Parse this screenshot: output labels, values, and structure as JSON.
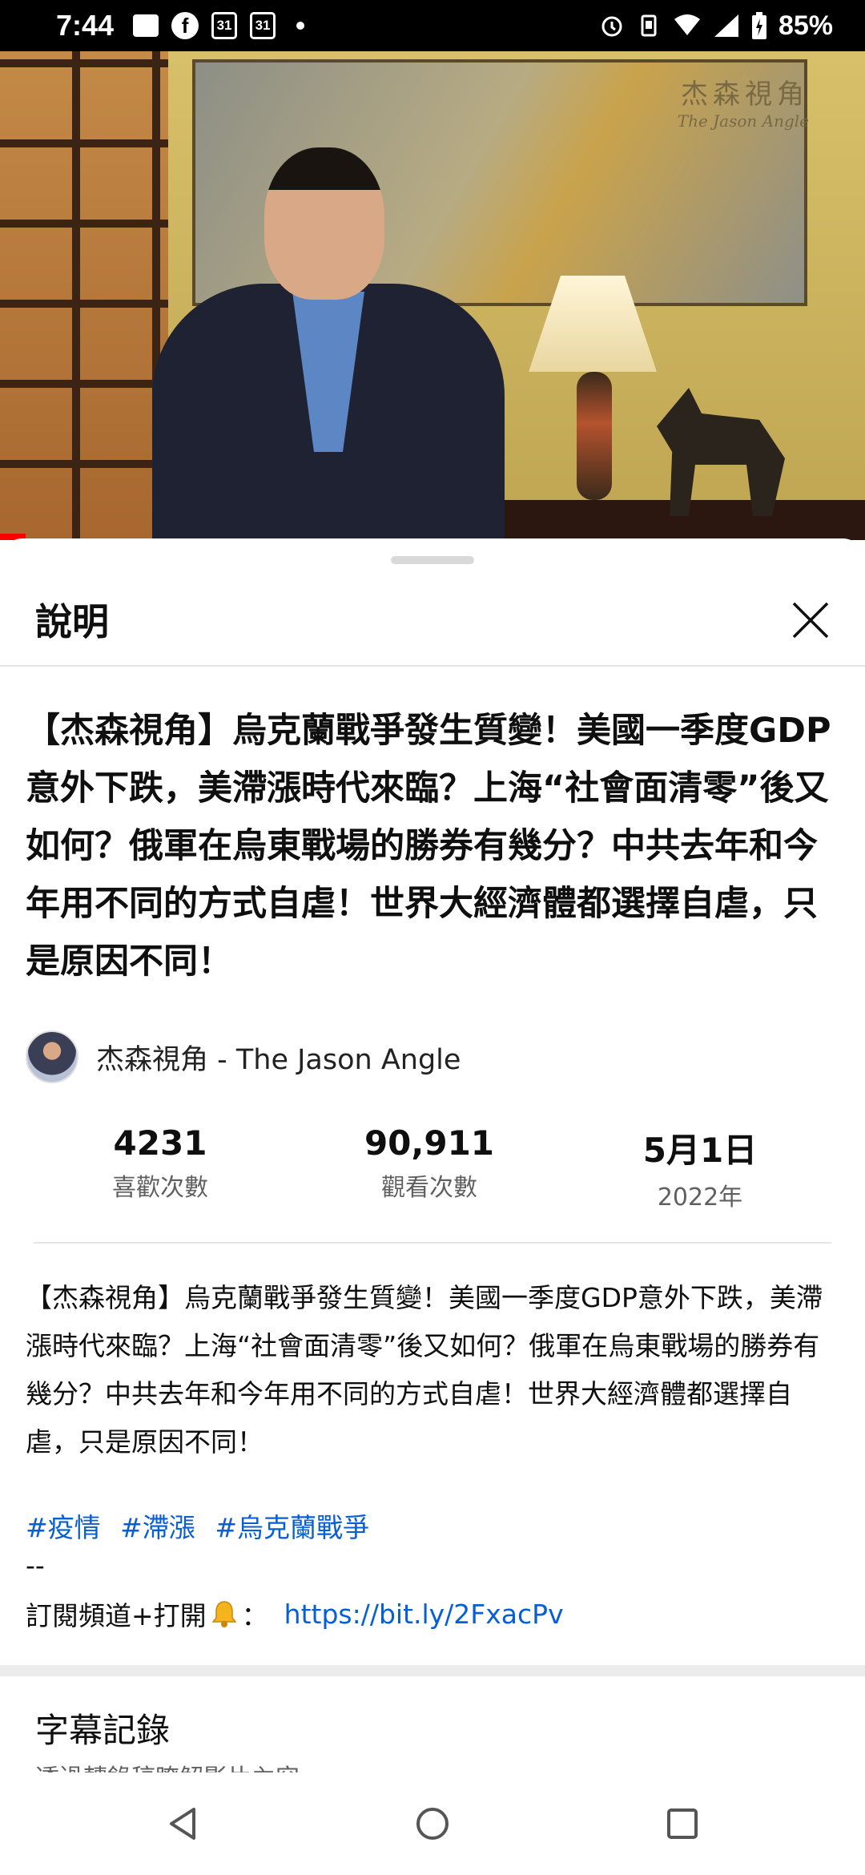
{
  "status_bar": {
    "time": "7:44",
    "calendar_day_1": "31",
    "calendar_day_2": "31",
    "battery": "85%"
  },
  "video": {
    "watermark_cn": "杰森視角",
    "watermark_en": "The Jason Angle",
    "progress_fraction": 0.03
  },
  "sheet": {
    "title": "說明",
    "video_title": "【杰森視角】烏克蘭戰爭發生質變！美國一季度GDP意外下跌，美滯漲時代來臨？上海“社會面清零”後又如何？俄軍在烏東戰場的勝券有幾分？中共去年和今年用不同的方式自虐！世界大經濟體都選擇自虐，只是原因不同！",
    "channel_name": "杰森視角 - The Jason Angle",
    "stats": {
      "likes_value": "4231",
      "likes_label": "喜歡次數",
      "views_value": "90,911",
      "views_label": "觀看次數",
      "date_value": "5月1日",
      "date_label": "2022年"
    },
    "description": "【杰森視角】烏克蘭戰爭發生質變！美國一季度GDP意外下跌，美滯漲時代來臨？上海“社會面清零”後又如何？俄軍在烏東戰場的勝券有幾分？中共去年和今年用不同的方式自虐！世界大經濟體都選擇自虐，只是原因不同！",
    "hashtags": [
      "#疫情",
      "#滯漲",
      "#烏克蘭戰爭"
    ],
    "dashes": "--",
    "subscribe_text": "訂閱頻道+打開",
    "subscribe_colon": "：",
    "subscribe_link": "https://bit.ly/2FxacPv",
    "transcript_title": "字幕記錄",
    "transcript_subtitle": "透過轉錄稿瞭解影片內容。"
  },
  "colors": {
    "link": "#065fd4",
    "progress": "#ff0000",
    "secondary_text": "#606060"
  }
}
